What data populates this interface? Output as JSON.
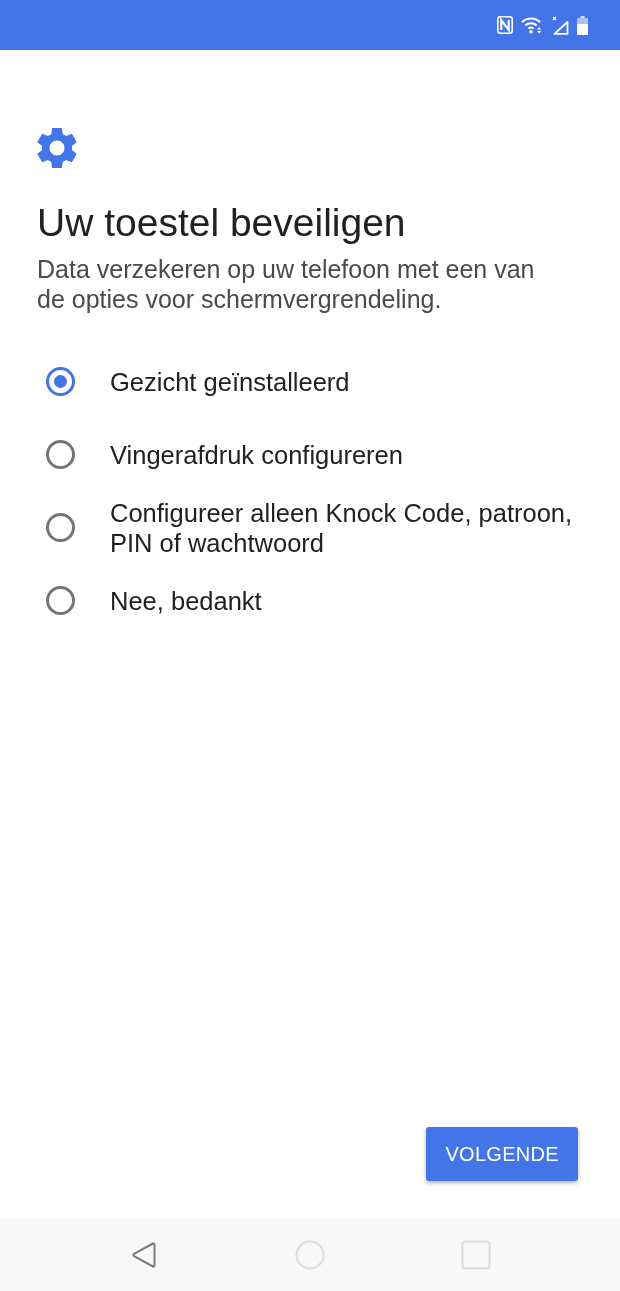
{
  "screen": {
    "title": "Uw toestel beveiligen",
    "description": "Data verzekeren op uw telefoon met een van de opties voor schermvergrendeling."
  },
  "options": [
    {
      "label": "Gezicht geïnstalleerd",
      "selected": true
    },
    {
      "label": "Vingerafdruk configureren",
      "selected": false
    },
    {
      "label": "Configureer alleen Knock Code, patroon, PIN of wachtwoord",
      "selected": false
    },
    {
      "label": "Nee, bedankt",
      "selected": false
    }
  ],
  "next_button": {
    "label": "VOLGENDE"
  },
  "nav_bar": [
    {
      "kind": "back",
      "disabled": false
    },
    {
      "kind": "home",
      "disabled": true
    },
    {
      "kind": "recents",
      "disabled": true
    }
  ]
}
